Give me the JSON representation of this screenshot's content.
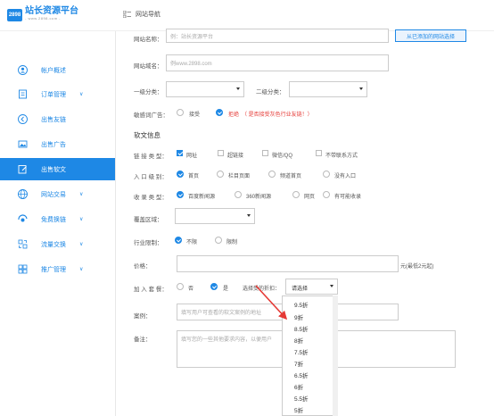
{
  "header": {
    "logo_badge": "2898",
    "logo_title": "站长资源平台",
    "logo_sub": "- www.2898.com -",
    "nav_label": "网站导航"
  },
  "sidebar": {
    "items": [
      {
        "label": "帐户概述",
        "icon": "user-icon",
        "chevron": ""
      },
      {
        "label": "订单管理",
        "icon": "document-icon",
        "chevron": "∨"
      },
      {
        "label": "出售友链",
        "icon": "link-icon",
        "chevron": ""
      },
      {
        "label": "出售广告",
        "icon": "image-icon",
        "chevron": ""
      },
      {
        "label": "出售软文",
        "icon": "edit-icon",
        "chevron": ""
      },
      {
        "label": "网站交易",
        "icon": "globe-icon",
        "chevron": "∨"
      },
      {
        "label": "免费换链",
        "icon": "exchange-icon",
        "chevron": "∨"
      },
      {
        "label": "流量交换",
        "icon": "traffic-icon",
        "chevron": "∨"
      },
      {
        "label": "推广管理",
        "icon": "grid-icon",
        "chevron": "∨"
      }
    ]
  },
  "form": {
    "site_name_label": "网站名称：",
    "site_name_placeholder": "例：站长资源平台",
    "pick_button": "从已添加的网站选择",
    "domain_label": "网站域名：",
    "domain_placeholder": "例www.2898.com",
    "cat1_label": "一级分类：",
    "cat2_label": "二级分类：",
    "gray_ad_label": "敏感词广告：",
    "gray_ad_accept": "接受",
    "gray_ad_reject": "拒绝",
    "gray_ad_note": "（ 是否接受灰色行业友链！）",
    "section_title": "软文信息",
    "link_type_label": "链 接 类 型：",
    "link_types": [
      "网址",
      "超链接",
      "微信/QQ",
      "不带联系方式"
    ],
    "entry_label": "入 口 级 别：",
    "entries": [
      "首页",
      "栏目页面",
      "频道首页",
      "没有入口"
    ],
    "index_label": "收 录 类 型：",
    "index_types": [
      "百度新闻源",
      "360新闻源",
      "网页",
      "有可能收录"
    ],
    "region_label": "覆盖区域：",
    "industry_label": "行业限制：",
    "industry_options": [
      "不限",
      "限制"
    ],
    "price_label": "价格：",
    "price_note": "元(最低2元起)",
    "package_label": "加 入 套 餐：",
    "package_no": "否",
    "package_yes": "是",
    "discount_label": "选择受的折扣：",
    "discount_select": "请选择",
    "case_label": "案例：",
    "case_placeholder": "填写用户可查看的软文案例的地址",
    "remark_label": "备注：",
    "remark_placeholder": "填写您的一些其他要求内容，以便用户"
  },
  "dropdown": {
    "options": [
      "9.5折",
      "9折",
      "8.5折",
      "8折",
      "7.5折",
      "7折",
      "6.5折",
      "6折",
      "5.5折",
      "5折"
    ]
  },
  "colors": {
    "accent": "#1e88e5",
    "warning": "#e53935"
  }
}
